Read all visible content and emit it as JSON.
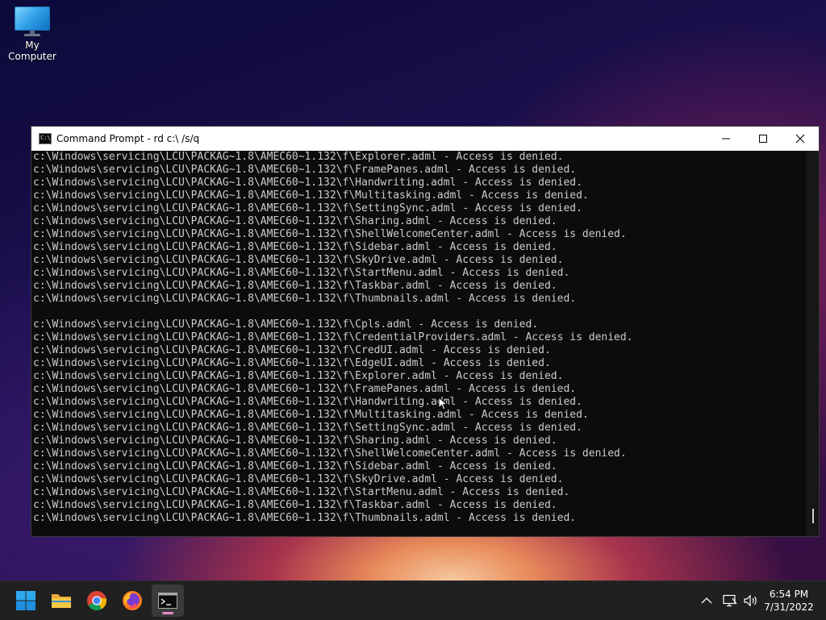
{
  "desktop": {
    "icons": [
      {
        "label": "My Computer",
        "icon": "monitor-icon"
      }
    ]
  },
  "window": {
    "title": "Command Prompt - rd  c:\\ /s/q",
    "controls": {
      "minimize": "—",
      "maximize": "☐",
      "close": "✕"
    },
    "lines": [
      "c:\\Windows\\servicing\\LCU\\PACKAG~1.8\\AMEC60~1.132\\f\\Explorer.adml - Access is denied.",
      "c:\\Windows\\servicing\\LCU\\PACKAG~1.8\\AMEC60~1.132\\f\\FramePanes.adml - Access is denied.",
      "c:\\Windows\\servicing\\LCU\\PACKAG~1.8\\AMEC60~1.132\\f\\Handwriting.adml - Access is denied.",
      "c:\\Windows\\servicing\\LCU\\PACKAG~1.8\\AMEC60~1.132\\f\\Multitasking.adml - Access is denied.",
      "c:\\Windows\\servicing\\LCU\\PACKAG~1.8\\AMEC60~1.132\\f\\SettingSync.adml - Access is denied.",
      "c:\\Windows\\servicing\\LCU\\PACKAG~1.8\\AMEC60~1.132\\f\\Sharing.adml - Access is denied.",
      "c:\\Windows\\servicing\\LCU\\PACKAG~1.8\\AMEC60~1.132\\f\\ShellWelcomeCenter.adml - Access is denied.",
      "c:\\Windows\\servicing\\LCU\\PACKAG~1.8\\AMEC60~1.132\\f\\Sidebar.adml - Access is denied.",
      "c:\\Windows\\servicing\\LCU\\PACKAG~1.8\\AMEC60~1.132\\f\\SkyDrive.adml - Access is denied.",
      "c:\\Windows\\servicing\\LCU\\PACKAG~1.8\\AMEC60~1.132\\f\\StartMenu.adml - Access is denied.",
      "c:\\Windows\\servicing\\LCU\\PACKAG~1.8\\AMEC60~1.132\\f\\Taskbar.adml - Access is denied.",
      "c:\\Windows\\servicing\\LCU\\PACKAG~1.8\\AMEC60~1.132\\f\\Thumbnails.adml - Access is denied.",
      "",
      "c:\\Windows\\servicing\\LCU\\PACKAG~1.8\\AMEC60~1.132\\f\\Cpls.adml - Access is denied.",
      "c:\\Windows\\servicing\\LCU\\PACKAG~1.8\\AMEC60~1.132\\f\\CredentialProviders.adml - Access is denied.",
      "c:\\Windows\\servicing\\LCU\\PACKAG~1.8\\AMEC60~1.132\\f\\CredUI.adml - Access is denied.",
      "c:\\Windows\\servicing\\LCU\\PACKAG~1.8\\AMEC60~1.132\\f\\EdgeUI.adml - Access is denied.",
      "c:\\Windows\\servicing\\LCU\\PACKAG~1.8\\AMEC60~1.132\\f\\Explorer.adml - Access is denied.",
      "c:\\Windows\\servicing\\LCU\\PACKAG~1.8\\AMEC60~1.132\\f\\FramePanes.adml - Access is denied.",
      "c:\\Windows\\servicing\\LCU\\PACKAG~1.8\\AMEC60~1.132\\f\\Handwriting.adml - Access is denied.",
      "c:\\Windows\\servicing\\LCU\\PACKAG~1.8\\AMEC60~1.132\\f\\Multitasking.adml - Access is denied.",
      "c:\\Windows\\servicing\\LCU\\PACKAG~1.8\\AMEC60~1.132\\f\\SettingSync.adml - Access is denied.",
      "c:\\Windows\\servicing\\LCU\\PACKAG~1.8\\AMEC60~1.132\\f\\Sharing.adml - Access is denied.",
      "c:\\Windows\\servicing\\LCU\\PACKAG~1.8\\AMEC60~1.132\\f\\ShellWelcomeCenter.adml - Access is denied.",
      "c:\\Windows\\servicing\\LCU\\PACKAG~1.8\\AMEC60~1.132\\f\\Sidebar.adml - Access is denied.",
      "c:\\Windows\\servicing\\LCU\\PACKAG~1.8\\AMEC60~1.132\\f\\SkyDrive.adml - Access is denied.",
      "c:\\Windows\\servicing\\LCU\\PACKAG~1.8\\AMEC60~1.132\\f\\StartMenu.adml - Access is denied.",
      "c:\\Windows\\servicing\\LCU\\PACKAG~1.8\\AMEC60~1.132\\f\\Taskbar.adml - Access is denied.",
      "c:\\Windows\\servicing\\LCU\\PACKAG~1.8\\AMEC60~1.132\\f\\Thumbnails.adml - Access is denied."
    ]
  },
  "taskbar": {
    "apps": [
      {
        "name": "start",
        "icon": "windows-logo-icon"
      },
      {
        "name": "file-explorer",
        "icon": "folder-icon"
      },
      {
        "name": "chrome",
        "icon": "chrome-icon"
      },
      {
        "name": "firefox",
        "icon": "firefox-icon"
      },
      {
        "name": "command-prompt",
        "icon": "terminal-icon",
        "active": true
      }
    ],
    "tray": {
      "icons": [
        "chevron-up-icon",
        "network-icon",
        "volume-icon"
      ],
      "time": "6:54 PM",
      "date": "7/31/2022"
    }
  },
  "colors": {
    "console_bg": "#0c0c0c",
    "console_text": "#cccccc",
    "taskbar_bg": "#202020",
    "active_indicator": "#e58cc8"
  }
}
